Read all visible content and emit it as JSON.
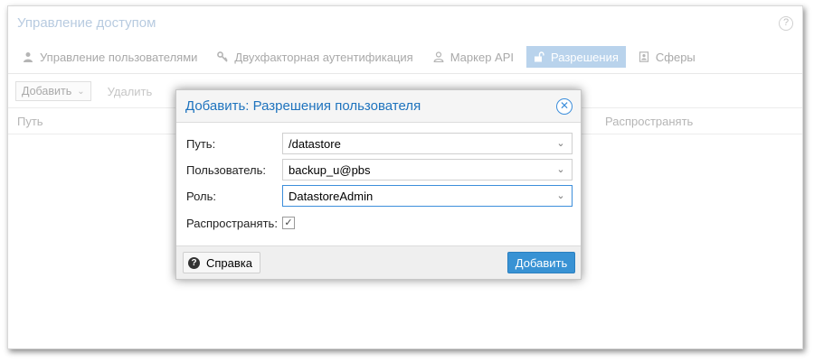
{
  "window": {
    "title": "Управление доступом",
    "help_icon": "question-circle-icon"
  },
  "tabs": [
    {
      "label": "Управление пользователями",
      "icon": "user-icon",
      "active": false
    },
    {
      "label": "Двухфакторная аутентификация",
      "icon": "key-icon",
      "active": false
    },
    {
      "label": "Маркер API",
      "icon": "user-outline-icon",
      "active": false
    },
    {
      "label": "Разрешения",
      "icon": "unlock-icon",
      "active": true
    },
    {
      "label": "Сферы",
      "icon": "address-book-icon",
      "active": false
    }
  ],
  "toolbar": {
    "add_label": "Добавить",
    "remove_label": "Удалить"
  },
  "grid": {
    "columns": [
      "Путь",
      "Распространять"
    ]
  },
  "dialog": {
    "title": "Добавить: Разрешения пользователя",
    "fields": {
      "path_label": "Путь:",
      "path_value": "/datastore",
      "user_label": "Пользователь:",
      "user_value": "backup_u@pbs",
      "role_label": "Роль:",
      "role_value": "DatastoreAdmin",
      "propagate_label": "Распространять:",
      "propagate_checked": true
    },
    "help_button": "Справка",
    "submit_button": "Добавить"
  },
  "colors": {
    "accent": "#3892d4",
    "title_blue": "#1e73be",
    "active_tab": "#b9d3ec"
  }
}
